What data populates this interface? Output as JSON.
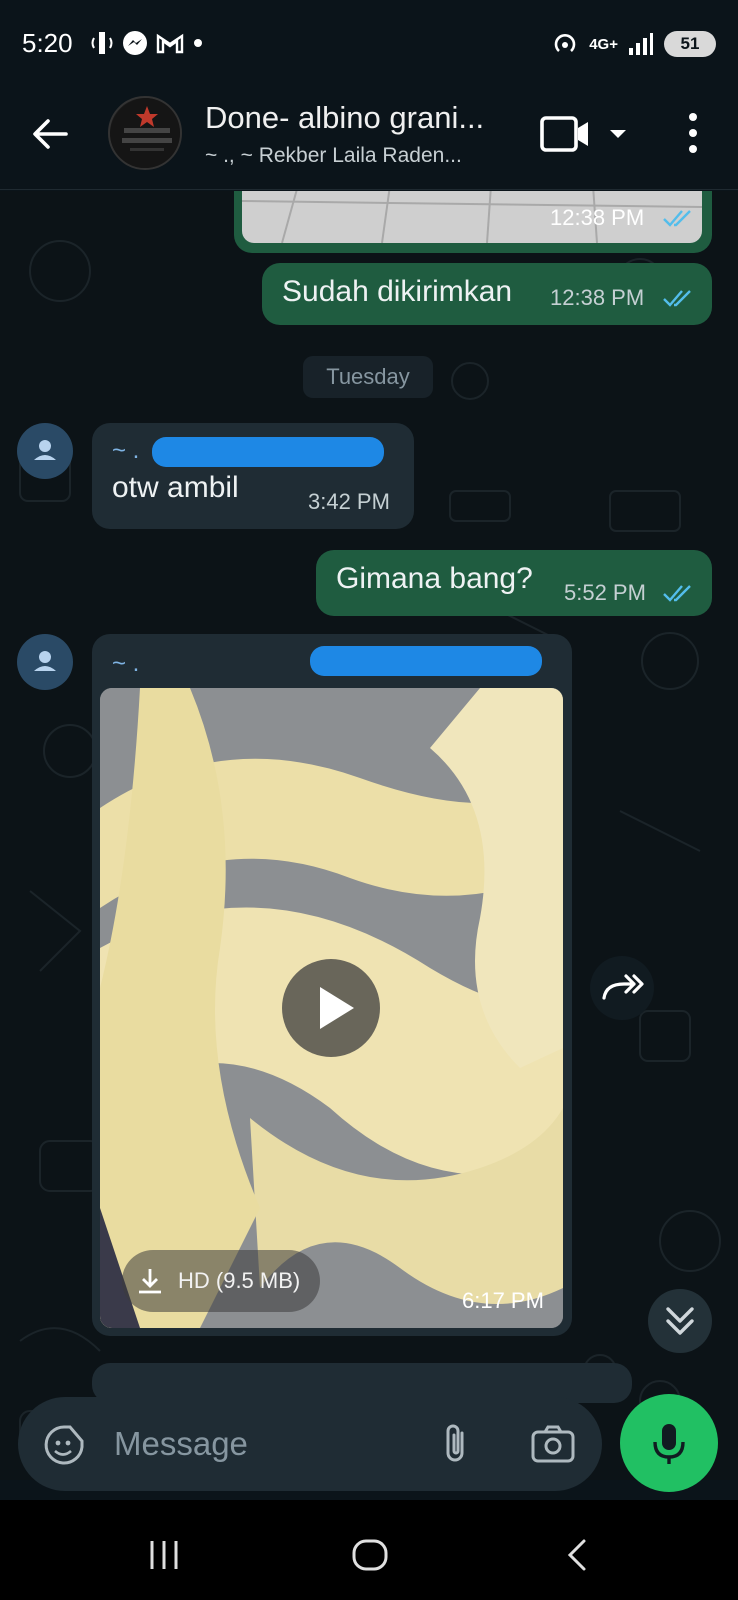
{
  "status_bar": {
    "time": "5:20",
    "network": "4G+",
    "battery": "51"
  },
  "header": {
    "title": "Done- albino grani...",
    "subtitle": "~ ., ~ Rekber Laila Raden...",
    "avatar_text": "REKBER LAILA RADEN"
  },
  "messages": {
    "m1": {
      "time": "12:38 PM"
    },
    "m2": {
      "text": "Sudah dikirimkan",
      "time": "12:38 PM"
    },
    "day_divider": "Tuesday",
    "m3": {
      "sender": "~ .",
      "text": "otw ambil",
      "time": "3:42 PM"
    },
    "m4": {
      "text": "Gimana bang?",
      "time": "5:52 PM"
    },
    "m5": {
      "sender": "~ .",
      "video_size": "HD (9.5 MB)",
      "time": "6:17 PM"
    }
  },
  "input": {
    "placeholder": "Message"
  },
  "colors": {
    "outgoing_bubble": "#1f5c40",
    "incoming_bubble": "#1f2c34",
    "accent_green": "#21c063",
    "ticks_blue": "#53bdeb"
  }
}
